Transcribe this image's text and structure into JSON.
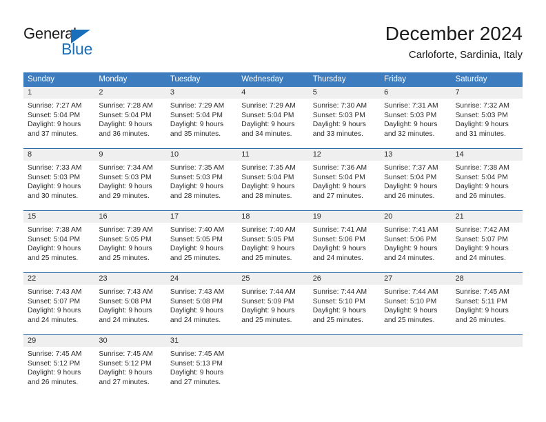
{
  "brand": {
    "name_part1": "General",
    "name_part2": "Blue",
    "triangle_icon": "triangle-icon",
    "color_primary": "#1a6fbb",
    "color_text": "#1a1a1a"
  },
  "header": {
    "title": "December 2024",
    "subtitle": "Carloforte, Sardinia, Italy"
  },
  "calendar": {
    "header_bg": "#3d7cbf",
    "week_divider": "#23639f",
    "daynum_bg": "#efefef",
    "weekdays": [
      "Sunday",
      "Monday",
      "Tuesday",
      "Wednesday",
      "Thursday",
      "Friday",
      "Saturday"
    ],
    "weeks": [
      [
        {
          "day": "1",
          "sunrise": "Sunrise: 7:27 AM",
          "sunset": "Sunset: 5:04 PM",
          "daylight1": "Daylight: 9 hours",
          "daylight2": "and 37 minutes."
        },
        {
          "day": "2",
          "sunrise": "Sunrise: 7:28 AM",
          "sunset": "Sunset: 5:04 PM",
          "daylight1": "Daylight: 9 hours",
          "daylight2": "and 36 minutes."
        },
        {
          "day": "3",
          "sunrise": "Sunrise: 7:29 AM",
          "sunset": "Sunset: 5:04 PM",
          "daylight1": "Daylight: 9 hours",
          "daylight2": "and 35 minutes."
        },
        {
          "day": "4",
          "sunrise": "Sunrise: 7:29 AM",
          "sunset": "Sunset: 5:04 PM",
          "daylight1": "Daylight: 9 hours",
          "daylight2": "and 34 minutes."
        },
        {
          "day": "5",
          "sunrise": "Sunrise: 7:30 AM",
          "sunset": "Sunset: 5:03 PM",
          "daylight1": "Daylight: 9 hours",
          "daylight2": "and 33 minutes."
        },
        {
          "day": "6",
          "sunrise": "Sunrise: 7:31 AM",
          "sunset": "Sunset: 5:03 PM",
          "daylight1": "Daylight: 9 hours",
          "daylight2": "and 32 minutes."
        },
        {
          "day": "7",
          "sunrise": "Sunrise: 7:32 AM",
          "sunset": "Sunset: 5:03 PM",
          "daylight1": "Daylight: 9 hours",
          "daylight2": "and 31 minutes."
        }
      ],
      [
        {
          "day": "8",
          "sunrise": "Sunrise: 7:33 AM",
          "sunset": "Sunset: 5:03 PM",
          "daylight1": "Daylight: 9 hours",
          "daylight2": "and 30 minutes."
        },
        {
          "day": "9",
          "sunrise": "Sunrise: 7:34 AM",
          "sunset": "Sunset: 5:03 PM",
          "daylight1": "Daylight: 9 hours",
          "daylight2": "and 29 minutes."
        },
        {
          "day": "10",
          "sunrise": "Sunrise: 7:35 AM",
          "sunset": "Sunset: 5:03 PM",
          "daylight1": "Daylight: 9 hours",
          "daylight2": "and 28 minutes."
        },
        {
          "day": "11",
          "sunrise": "Sunrise: 7:35 AM",
          "sunset": "Sunset: 5:04 PM",
          "daylight1": "Daylight: 9 hours",
          "daylight2": "and 28 minutes."
        },
        {
          "day": "12",
          "sunrise": "Sunrise: 7:36 AM",
          "sunset": "Sunset: 5:04 PM",
          "daylight1": "Daylight: 9 hours",
          "daylight2": "and 27 minutes."
        },
        {
          "day": "13",
          "sunrise": "Sunrise: 7:37 AM",
          "sunset": "Sunset: 5:04 PM",
          "daylight1": "Daylight: 9 hours",
          "daylight2": "and 26 minutes."
        },
        {
          "day": "14",
          "sunrise": "Sunrise: 7:38 AM",
          "sunset": "Sunset: 5:04 PM",
          "daylight1": "Daylight: 9 hours",
          "daylight2": "and 26 minutes."
        }
      ],
      [
        {
          "day": "15",
          "sunrise": "Sunrise: 7:38 AM",
          "sunset": "Sunset: 5:04 PM",
          "daylight1": "Daylight: 9 hours",
          "daylight2": "and 25 minutes."
        },
        {
          "day": "16",
          "sunrise": "Sunrise: 7:39 AM",
          "sunset": "Sunset: 5:05 PM",
          "daylight1": "Daylight: 9 hours",
          "daylight2": "and 25 minutes."
        },
        {
          "day": "17",
          "sunrise": "Sunrise: 7:40 AM",
          "sunset": "Sunset: 5:05 PM",
          "daylight1": "Daylight: 9 hours",
          "daylight2": "and 25 minutes."
        },
        {
          "day": "18",
          "sunrise": "Sunrise: 7:40 AM",
          "sunset": "Sunset: 5:05 PM",
          "daylight1": "Daylight: 9 hours",
          "daylight2": "and 25 minutes."
        },
        {
          "day": "19",
          "sunrise": "Sunrise: 7:41 AM",
          "sunset": "Sunset: 5:06 PM",
          "daylight1": "Daylight: 9 hours",
          "daylight2": "and 24 minutes."
        },
        {
          "day": "20",
          "sunrise": "Sunrise: 7:41 AM",
          "sunset": "Sunset: 5:06 PM",
          "daylight1": "Daylight: 9 hours",
          "daylight2": "and 24 minutes."
        },
        {
          "day": "21",
          "sunrise": "Sunrise: 7:42 AM",
          "sunset": "Sunset: 5:07 PM",
          "daylight1": "Daylight: 9 hours",
          "daylight2": "and 24 minutes."
        }
      ],
      [
        {
          "day": "22",
          "sunrise": "Sunrise: 7:43 AM",
          "sunset": "Sunset: 5:07 PM",
          "daylight1": "Daylight: 9 hours",
          "daylight2": "and 24 minutes."
        },
        {
          "day": "23",
          "sunrise": "Sunrise: 7:43 AM",
          "sunset": "Sunset: 5:08 PM",
          "daylight1": "Daylight: 9 hours",
          "daylight2": "and 24 minutes."
        },
        {
          "day": "24",
          "sunrise": "Sunrise: 7:43 AM",
          "sunset": "Sunset: 5:08 PM",
          "daylight1": "Daylight: 9 hours",
          "daylight2": "and 24 minutes."
        },
        {
          "day": "25",
          "sunrise": "Sunrise: 7:44 AM",
          "sunset": "Sunset: 5:09 PM",
          "daylight1": "Daylight: 9 hours",
          "daylight2": "and 25 minutes."
        },
        {
          "day": "26",
          "sunrise": "Sunrise: 7:44 AM",
          "sunset": "Sunset: 5:10 PM",
          "daylight1": "Daylight: 9 hours",
          "daylight2": "and 25 minutes."
        },
        {
          "day": "27",
          "sunrise": "Sunrise: 7:44 AM",
          "sunset": "Sunset: 5:10 PM",
          "daylight1": "Daylight: 9 hours",
          "daylight2": "and 25 minutes."
        },
        {
          "day": "28",
          "sunrise": "Sunrise: 7:45 AM",
          "sunset": "Sunset: 5:11 PM",
          "daylight1": "Daylight: 9 hours",
          "daylight2": "and 26 minutes."
        }
      ],
      [
        {
          "day": "29",
          "sunrise": "Sunrise: 7:45 AM",
          "sunset": "Sunset: 5:12 PM",
          "daylight1": "Daylight: 9 hours",
          "daylight2": "and 26 minutes."
        },
        {
          "day": "30",
          "sunrise": "Sunrise: 7:45 AM",
          "sunset": "Sunset: 5:12 PM",
          "daylight1": "Daylight: 9 hours",
          "daylight2": "and 27 minutes."
        },
        {
          "day": "31",
          "sunrise": "Sunrise: 7:45 AM",
          "sunset": "Sunset: 5:13 PM",
          "daylight1": "Daylight: 9 hours",
          "daylight2": "and 27 minutes."
        },
        {
          "day": "",
          "sunrise": "",
          "sunset": "",
          "daylight1": "",
          "daylight2": ""
        },
        {
          "day": "",
          "sunrise": "",
          "sunset": "",
          "daylight1": "",
          "daylight2": ""
        },
        {
          "day": "",
          "sunrise": "",
          "sunset": "",
          "daylight1": "",
          "daylight2": ""
        },
        {
          "day": "",
          "sunrise": "",
          "sunset": "",
          "daylight1": "",
          "daylight2": ""
        }
      ]
    ]
  }
}
